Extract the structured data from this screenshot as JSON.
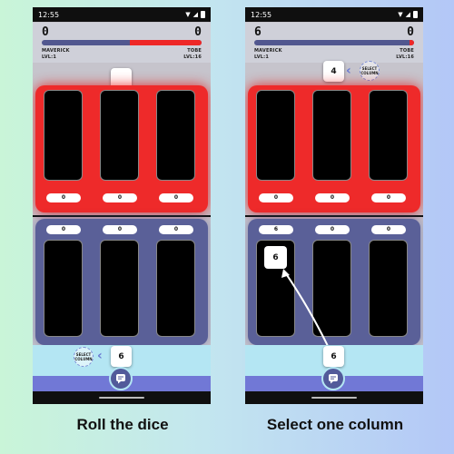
{
  "status": {
    "time": "12:55"
  },
  "colors": {
    "player_red": "#ee2727",
    "player_blue": "#51578f",
    "accent": "#7178d6"
  },
  "left": {
    "score_left": "0",
    "score_right": "0",
    "player_left": {
      "name": "MAVERICK",
      "level": "LVL:1"
    },
    "player_right": {
      "name": "TOBE",
      "level": "LVL:16"
    },
    "hp_red_fraction": 0.45,
    "top_die": "",
    "red_totals": [
      "0",
      "0",
      "0"
    ],
    "blue_totals": [
      "0",
      "0",
      "0"
    ],
    "select_label": "SELECT COLUMN",
    "bottom_die": "6",
    "caption": "Roll the dice"
  },
  "right": {
    "score_left": "6",
    "score_right": "0",
    "player_left": {
      "name": "MAVERICK",
      "level": "LVL:1"
    },
    "player_right": {
      "name": "TOBE",
      "level": "LVL:16"
    },
    "hp_red_fraction": 0.03,
    "top_die": "4",
    "select_label": "SELECT COLUMN",
    "red_totals": [
      "0",
      "0",
      "0"
    ],
    "blue_totals": [
      "6",
      "0",
      "0"
    ],
    "placed_die": "6",
    "bottom_die": "6",
    "caption": "Select one column"
  }
}
